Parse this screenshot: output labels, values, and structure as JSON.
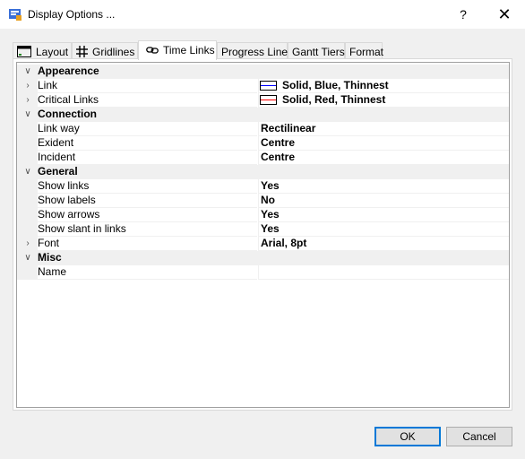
{
  "window": {
    "title": "Display Options ...",
    "help_label": "?",
    "close_label": "✕"
  },
  "tabs": [
    {
      "label": "Layout",
      "icon": "layout-icon"
    },
    {
      "label": "Gridlines",
      "icon": "gridlines-icon"
    },
    {
      "label": "Time Links",
      "icon": "link-icon",
      "active": true
    },
    {
      "label": "Progress Lines"
    },
    {
      "label": "Gantt Tiers"
    },
    {
      "label": "Format"
    }
  ],
  "grid": {
    "categories": [
      {
        "name": "Appearence"
      },
      {
        "name": "Connection"
      },
      {
        "name": "General"
      },
      {
        "name": "Misc"
      }
    ],
    "props": {
      "link": {
        "name": "Link",
        "value": "Solid, Blue, Thinnest",
        "swatch_color": "#0000ff"
      },
      "critical_links": {
        "name": "Critical Links",
        "value": "Solid, Red, Thinnest",
        "swatch_color": "#ff0000"
      },
      "link_way": {
        "name": "Link way",
        "value": "Rectilinear"
      },
      "exident": {
        "name": "Exident",
        "value": "Centre"
      },
      "incident": {
        "name": "Incident",
        "value": "Centre"
      },
      "show_links": {
        "name": "Show links",
        "value": "Yes"
      },
      "show_labels": {
        "name": "Show labels",
        "value": "No"
      },
      "show_arrows": {
        "name": "Show arrows",
        "value": "Yes"
      },
      "show_slant": {
        "name": "Show slant in links",
        "value": "Yes"
      },
      "font": {
        "name": "Font",
        "value": "Arial, 8pt"
      },
      "name": {
        "name": "Name",
        "value": ""
      }
    }
  },
  "buttons": {
    "ok": "OK",
    "cancel": "Cancel"
  },
  "colors": {
    "accent": "#0078d7"
  }
}
